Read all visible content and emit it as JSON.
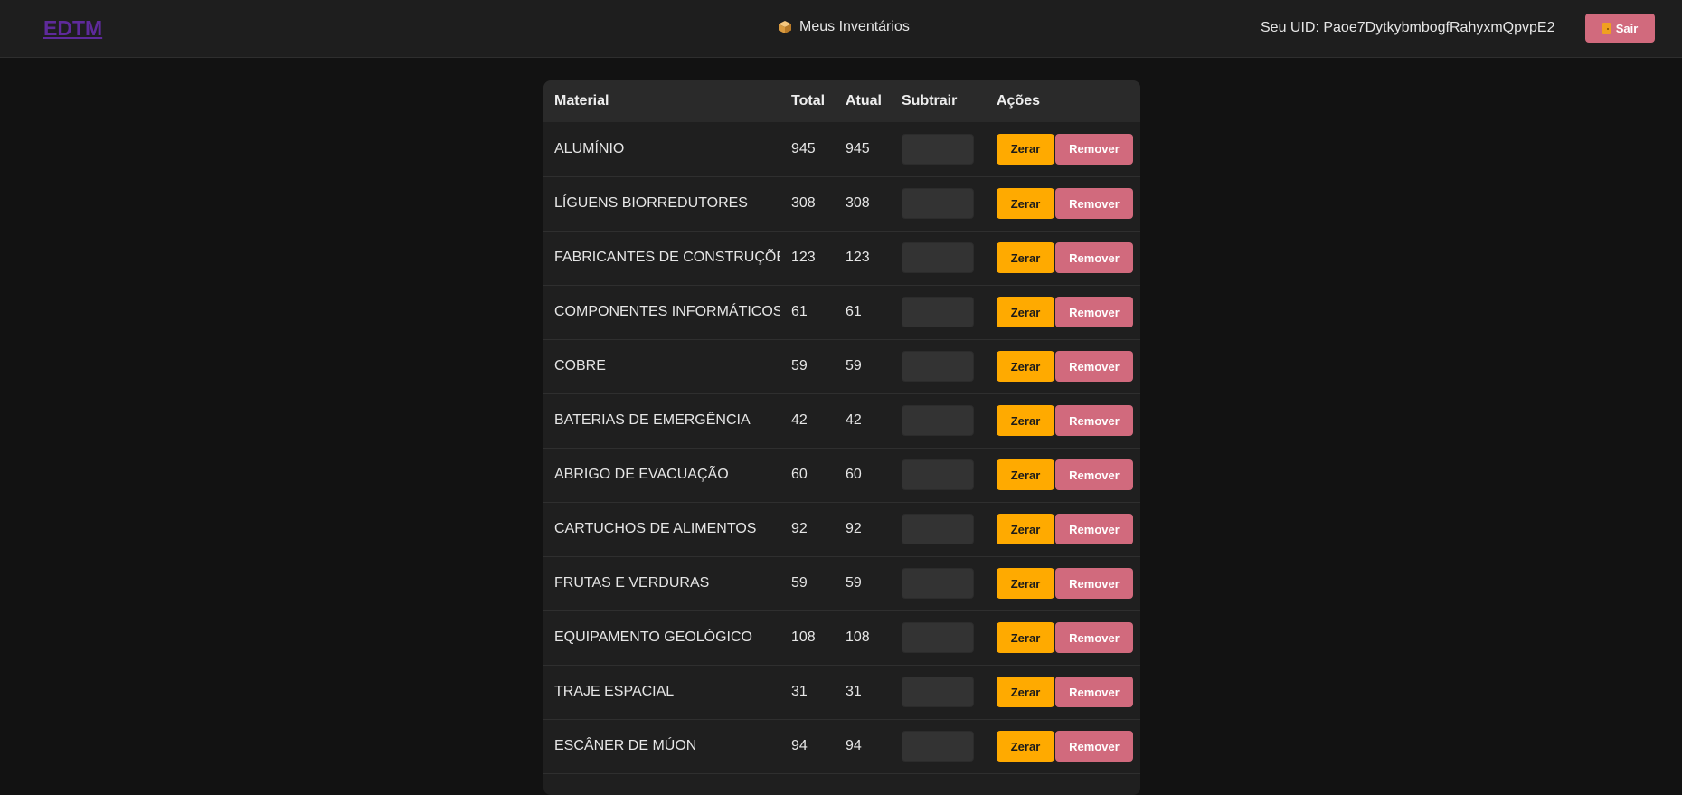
{
  "header": {
    "logo": "EDTM",
    "title": "Meus Inventários",
    "title_icon": "box-icon",
    "uid_label": "Seu UID: Paoe7DytkybmbogfRahyxmQpvpE2",
    "logout_label": "Sair",
    "logout_icon": "door-icon"
  },
  "colors": {
    "background": "#121212",
    "header": "#1e1e1e",
    "logo": "#5e2a9b",
    "zerar": "#ffaa00",
    "remover": "#d16a7d"
  },
  "table": {
    "columns": [
      "Material",
      "Total",
      "Atual",
      "Subtrair",
      "Ações"
    ],
    "rows": [
      {
        "material": "ALUMÍNIO",
        "total": "945",
        "atual": "945",
        "subtrair": "",
        "zerar": "Zerar",
        "remover": "Remover"
      },
      {
        "material": "LÍGUENS BIORREDUTORES",
        "total": "308",
        "atual": "308",
        "subtrair": "",
        "zerar": "Zerar",
        "remover": "Remover"
      },
      {
        "material": "FABRICANTES DE CONSTRUÇÕES",
        "total": "123",
        "atual": "123",
        "subtrair": "",
        "zerar": "Zerar",
        "remover": "Remover"
      },
      {
        "material": "COMPONENTES INFORMÁTICOS",
        "total": "61",
        "atual": "61",
        "subtrair": "",
        "zerar": "Zerar",
        "remover": "Remover"
      },
      {
        "material": "COBRE",
        "total": "59",
        "atual": "59",
        "subtrair": "",
        "zerar": "Zerar",
        "remover": "Remover"
      },
      {
        "material": "BATERIAS DE EMERGÊNCIA",
        "total": "42",
        "atual": "42",
        "subtrair": "",
        "zerar": "Zerar",
        "remover": "Remover"
      },
      {
        "material": "ABRIGO DE EVACUAÇÃO",
        "total": "60",
        "atual": "60",
        "subtrair": "",
        "zerar": "Zerar",
        "remover": "Remover"
      },
      {
        "material": "CARTUCHOS DE ALIMENTOS",
        "total": "92",
        "atual": "92",
        "subtrair": "",
        "zerar": "Zerar",
        "remover": "Remover"
      },
      {
        "material": "FRUTAS E VERDURAS",
        "total": "59",
        "atual": "59",
        "subtrair": "",
        "zerar": "Zerar",
        "remover": "Remover"
      },
      {
        "material": "EQUIPAMENTO GEOLÓGICO",
        "total": "108",
        "atual": "108",
        "subtrair": "",
        "zerar": "Zerar",
        "remover": "Remover"
      },
      {
        "material": "TRAJE ESPACIAL",
        "total": "31",
        "atual": "31",
        "subtrair": "",
        "zerar": "Zerar",
        "remover": "Remover"
      },
      {
        "material": "ESCÂNER DE MÚON",
        "total": "94",
        "atual": "94",
        "subtrair": "",
        "zerar": "Zerar",
        "remover": "Remover"
      }
    ]
  }
}
